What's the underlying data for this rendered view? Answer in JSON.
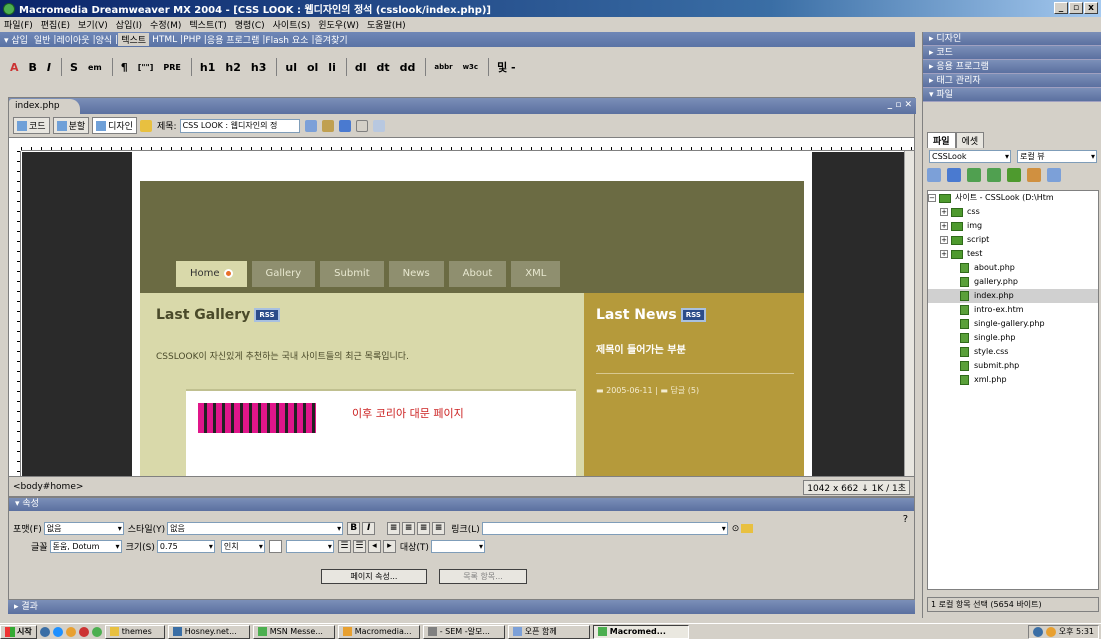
{
  "window": {
    "title": "Macromedia Dreamweaver MX 2004 - [CSS LOOK : 웹디자인의 정석 (csslook/index.php)]",
    "controls": [
      "_",
      "▫",
      "x"
    ]
  },
  "menu": [
    "파일(F)",
    "편집(E)",
    "보기(V)",
    "삽입(I)",
    "수정(M)",
    "텍스트(T)",
    "명령(C)",
    "사이트(S)",
    "윈도우(W)",
    "도움말(H)"
  ],
  "insert_bar": {
    "toggle": "▾ 삽입",
    "tabs": [
      "일반",
      "레이아웃",
      "양식",
      "텍스트",
      "HTML",
      "PHP",
      "응용 프로그램",
      "Flash 요소",
      "즐겨찾기"
    ],
    "active_tab": "텍스트"
  },
  "text_tools": [
    "B",
    "I",
    "S",
    "em",
    "¶",
    "[\"\"]",
    "PRE",
    "h1",
    "h2",
    "h3",
    "ul",
    "ol",
    "li",
    "dl",
    "dt",
    "dd",
    "abbr",
    "w3c",
    "및 -"
  ],
  "document": {
    "tab": "index.php",
    "view_buttons": [
      "코드",
      "분할",
      "디자인"
    ],
    "title_label": "제목:",
    "title_value": "CSS LOOK : 웹디자인의 정",
    "tag_selector": "<body#home>",
    "size_info": "1042 x 662 ↓ 1K / 1초"
  },
  "website": {
    "nav": [
      "Home",
      "Gallery",
      "Submit",
      "News",
      "About",
      "XML"
    ],
    "active_nav": "Home",
    "gallery_heading": "Last Gallery",
    "rss": "RSS",
    "gallery_desc": "CSSLOOK이 자신있게 추천하는 국내 사이트들의 최근 목록입니다.",
    "card_title": "이후 코리아 대문 페이지",
    "news_heading": "Last News",
    "news_sub": "제목이 들어가는 부분",
    "news_date": "2005-06-11",
    "news_comments": "답글 (5)"
  },
  "properties": {
    "header": "▾ 속성",
    "format_label": "포맷(F)",
    "format_value": "없음",
    "style_label": "스타일(Y)",
    "style_value": "없음",
    "link_label": "링크(L)",
    "font_label": "글꼴",
    "font_value": "돋움, Dotum",
    "size_label": "크기(S)",
    "size_value": "0.75",
    "unit_value": "인치",
    "target_label": "대상(T)",
    "page_props_btn": "페이지 속성...",
    "list_item_btn": "목록 항목..."
  },
  "results_header": "▸ 결과",
  "right_panels": {
    "headers": [
      "▸ 디자인",
      "▸ 코드",
      "▸ 응용 프로그램",
      "▸ 태그 관리자",
      "▾ 파일"
    ],
    "file_tabs": [
      "파일",
      "에셋"
    ],
    "site_select": "CSSLook",
    "view_select": "로컬 뷰",
    "root": "사이트 - CSSLook (D:\\Htm",
    "folders": [
      "css",
      "img",
      "script",
      "test"
    ],
    "files": [
      "about.php",
      "gallery.php",
      "index.php",
      "intro-ex.htm",
      "single-gallery.php",
      "single.php",
      "style.css",
      "submit.php",
      "xml.php"
    ],
    "selected_file": "index.php",
    "status": "1 로컬 항목 선택 (5654 바이트)"
  },
  "taskbar": {
    "start": "시작",
    "tasks": [
      "themes",
      "Hosney.net...",
      "MSN Messe...",
      "Macromedia...",
      "- SEM -알모...",
      "오픈 함께",
      "Macromed..."
    ],
    "active_task": "Macromed...",
    "clock": "오후 5:31"
  },
  "colors": {
    "title_bar": "#0a246a",
    "header_olive": "#6b6b43",
    "left_col": "#d9d9aa",
    "right_col": "#b59a3b",
    "rss_badge": "#2b4c8a"
  }
}
